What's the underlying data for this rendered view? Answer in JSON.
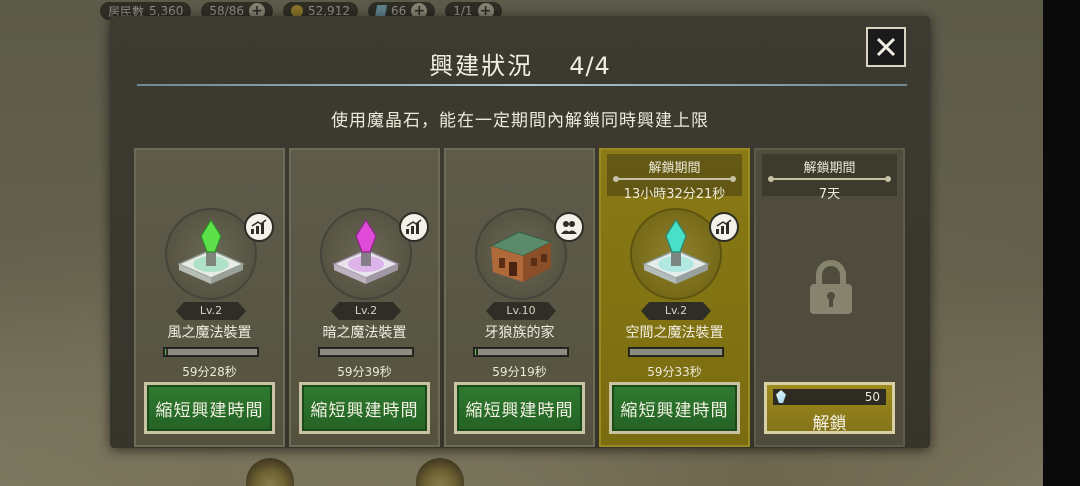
{
  "topbar": {
    "resident_label": "居民數",
    "resident_value": "5,360",
    "storage": "58/86",
    "coins": "52,912",
    "gems": "66",
    "extra": "1/1"
  },
  "modal": {
    "title": "興建狀況",
    "count": "4/4",
    "subtitle": "使用魔晶石，能在一定期間內解鎖同時興建上限",
    "close_icon": "close-icon"
  },
  "cards": [
    {
      "name": "風之魔法裝置",
      "level": "Lv.2",
      "time": "59分28秒",
      "progress": 0.03,
      "button": "縮短興建時間",
      "badge_icon": "stats-chart-icon",
      "crystal_color": "#5ee04a",
      "base_color": "#9fe0c0"
    },
    {
      "name": "暗之魔法裝置",
      "level": "Lv.2",
      "time": "59分39秒",
      "progress": 0.0,
      "button": "縮短興建時間",
      "badge_icon": "stats-chart-icon",
      "crystal_color": "#e04ad8",
      "base_color": "#d8a8e8"
    },
    {
      "name": "牙狼族的家",
      "level": "Lv.10",
      "time": "59分19秒",
      "progress": 0.03,
      "button": "縮短興建時間",
      "badge_icon": "residents-icon"
    },
    {
      "unlock_label": "解鎖期間",
      "unlock_value": "13小時32分21秒",
      "name": "空間之魔法裝置",
      "level": "Lv.2",
      "time": "59分33秒",
      "progress": 0.0,
      "button": "縮短興建時間",
      "badge_icon": "stats-chart-icon",
      "crystal_color": "#4ae0c8",
      "base_color": "#a8e8e0"
    },
    {
      "unlock_label": "解鎖期間",
      "unlock_value": "7天",
      "cost": "50",
      "button": "解鎖",
      "lock_icon": "padlock-icon"
    }
  ],
  "colors": {
    "progress_fill": "#4fc24f",
    "highlight_card": "#8a7a16",
    "speed_button": "#2f7a30",
    "unlock_button": "#9e8a1c"
  }
}
